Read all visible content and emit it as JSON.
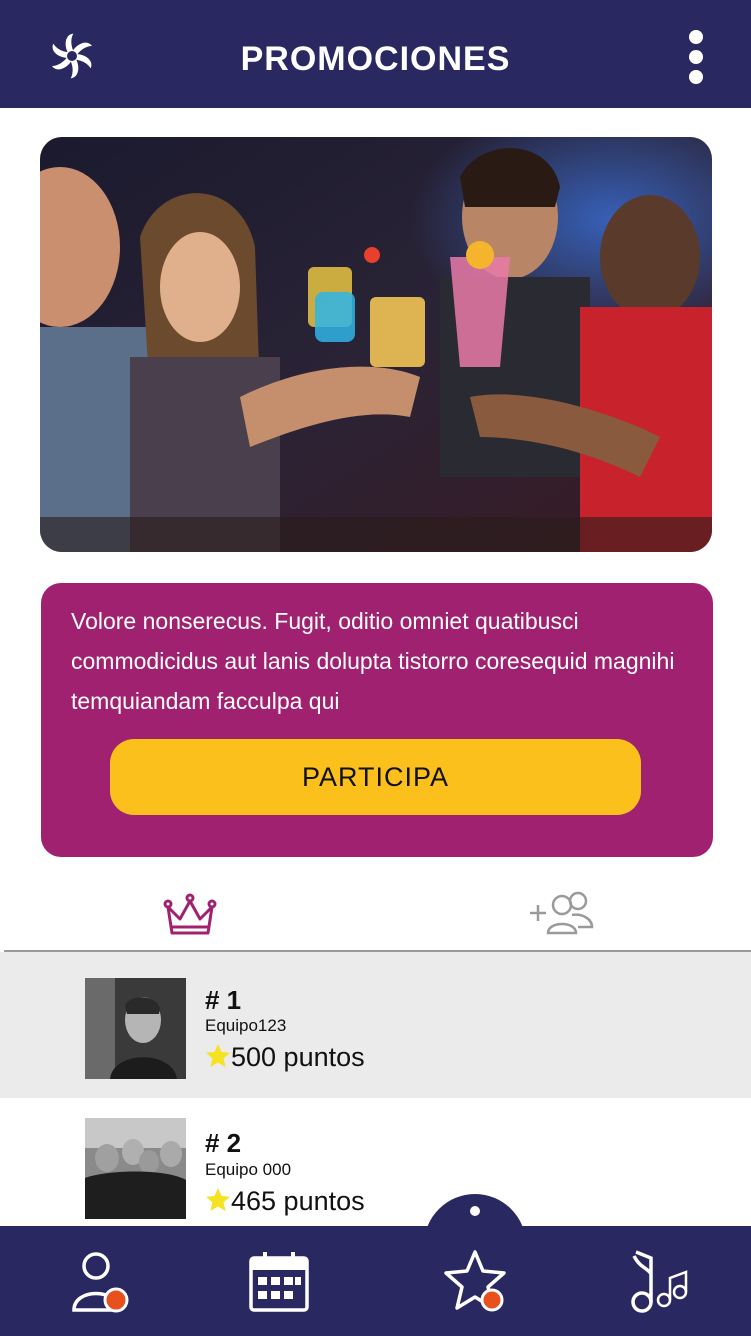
{
  "header": {
    "title": "PROMOCIONES",
    "logo_icon": "flower-logo-icon",
    "menu_icon": "kebab-menu-icon"
  },
  "promo": {
    "description": "Volore nonserecus. Fugit, oditio omniet quatibusci commodicidus aut lanis dolupta tistorro coresequid magnihi temquiandam facculpa qui",
    "cta_label": "PARTICIPA"
  },
  "tabs": [
    {
      "icon": "crown-icon",
      "active": true
    },
    {
      "icon": "add-friends-icon",
      "active": false
    }
  ],
  "ranking": [
    {
      "position": "# 1",
      "team": "Equipo123",
      "points": "500 puntos"
    },
    {
      "position": "# 2",
      "team": "Equipo 000",
      "points": "465 puntos"
    }
  ],
  "bottom_nav": [
    {
      "icon": "profile-icon",
      "badge": true
    },
    {
      "icon": "calendar-icon",
      "badge": false
    },
    {
      "icon": "star-icon",
      "badge": true,
      "active": true
    },
    {
      "icon": "music-icon",
      "badge": false
    }
  ],
  "colors": {
    "navy": "#2a2860",
    "magenta": "#a02170",
    "yellow": "#fbc01b",
    "badge_orange": "#e8501e",
    "star_yellow": "#f5e221"
  }
}
